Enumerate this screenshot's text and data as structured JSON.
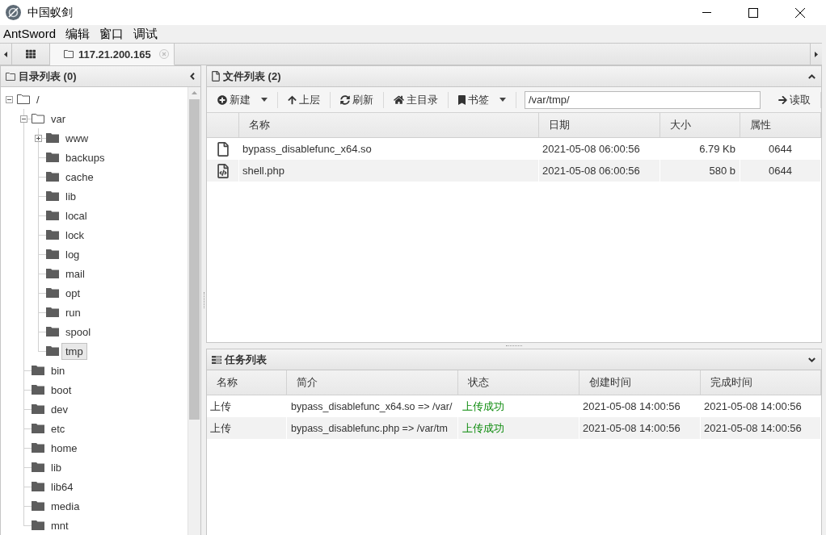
{
  "window": {
    "title": "中国蚁剑"
  },
  "menu": [
    "AntSword",
    "编辑",
    "窗口",
    "调试"
  ],
  "tabs": [
    {
      "kind": "home",
      "selected": false
    },
    {
      "kind": "shell",
      "label": "117.21.200.165",
      "selected": true
    }
  ],
  "directory_panel": {
    "title": "目录列表 (0)",
    "tree": [
      {
        "name": "/",
        "kind": "branch",
        "expanded": true,
        "selected": false,
        "children": [
          {
            "name": "var",
            "kind": "branch",
            "expanded": true,
            "selected": false,
            "children": [
              {
                "name": "www",
                "kind": "branch",
                "expanded": false,
                "selected": false
              },
              {
                "name": "backups",
                "kind": "leaf",
                "expanded": false,
                "selected": false
              },
              {
                "name": "cache",
                "kind": "leaf",
                "expanded": false,
                "selected": false
              },
              {
                "name": "lib",
                "kind": "leaf",
                "expanded": false,
                "selected": false
              },
              {
                "name": "local",
                "kind": "leaf",
                "expanded": false,
                "selected": false
              },
              {
                "name": "lock",
                "kind": "leaf",
                "expanded": false,
                "selected": false
              },
              {
                "name": "log",
                "kind": "leaf",
                "expanded": false,
                "selected": false
              },
              {
                "name": "mail",
                "kind": "leaf",
                "expanded": false,
                "selected": false
              },
              {
                "name": "opt",
                "kind": "leaf",
                "expanded": false,
                "selected": false
              },
              {
                "name": "run",
                "kind": "leaf",
                "expanded": false,
                "selected": false
              },
              {
                "name": "spool",
                "kind": "leaf",
                "expanded": false,
                "selected": false
              },
              {
                "name": "tmp",
                "kind": "leaf",
                "expanded": false,
                "selected": true
              }
            ]
          },
          {
            "name": "bin",
            "kind": "leaf",
            "expanded": false,
            "selected": false
          },
          {
            "name": "boot",
            "kind": "leaf",
            "expanded": false,
            "selected": false
          },
          {
            "name": "dev",
            "kind": "leaf",
            "expanded": false,
            "selected": false
          },
          {
            "name": "etc",
            "kind": "leaf",
            "expanded": false,
            "selected": false
          },
          {
            "name": "home",
            "kind": "leaf",
            "expanded": false,
            "selected": false
          },
          {
            "name": "lib",
            "kind": "leaf",
            "expanded": false,
            "selected": false
          },
          {
            "name": "lib64",
            "kind": "leaf",
            "expanded": false,
            "selected": false
          },
          {
            "name": "media",
            "kind": "leaf",
            "expanded": false,
            "selected": false
          },
          {
            "name": "mnt",
            "kind": "leaf",
            "expanded": false,
            "selected": false
          }
        ]
      }
    ]
  },
  "file_panel": {
    "title": "文件列表 (2)",
    "toolbar": {
      "buttons": [
        {
          "label": "新建",
          "dropdown": true
        },
        {
          "label": "上层",
          "dropdown": false
        },
        {
          "label": "刷新",
          "dropdown": false
        },
        {
          "label": "主目录",
          "dropdown": false
        },
        {
          "label": "书签",
          "dropdown": true
        }
      ],
      "path_field": {
        "value": "/var/tmp/"
      },
      "read_button": "读取"
    },
    "columns": [
      "名称",
      "日期",
      "大小",
      "属性"
    ],
    "rows": [
      {
        "kind": "file",
        "name": "bypass_disablefunc_x64.so",
        "date": "2021-05-08 06:00:56",
        "size": "6.79 Kb",
        "mode": "0644"
      },
      {
        "kind": "code",
        "name": "shell.php",
        "date": "2021-05-08 06:00:56",
        "size": "580 b",
        "mode": "0644"
      }
    ]
  },
  "task_panel": {
    "title": "任务列表",
    "columns": [
      "名称",
      "简介",
      "状态",
      "创建时间",
      "完成时间"
    ],
    "rows": [
      {
        "name": "上传",
        "summary": "bypass_disablefunc_x64.so => /var/",
        "status": "上传成功",
        "success": true,
        "created": "2021-05-08 14:00:56",
        "finished": "2021-05-08 14:00:56"
      },
      {
        "name": "上传",
        "summary": "bypass_disablefunc.php => /var/tm",
        "status": "上传成功",
        "success": true,
        "created": "2021-05-08 14:00:56",
        "finished": "2021-05-08 14:00:56"
      }
    ]
  }
}
